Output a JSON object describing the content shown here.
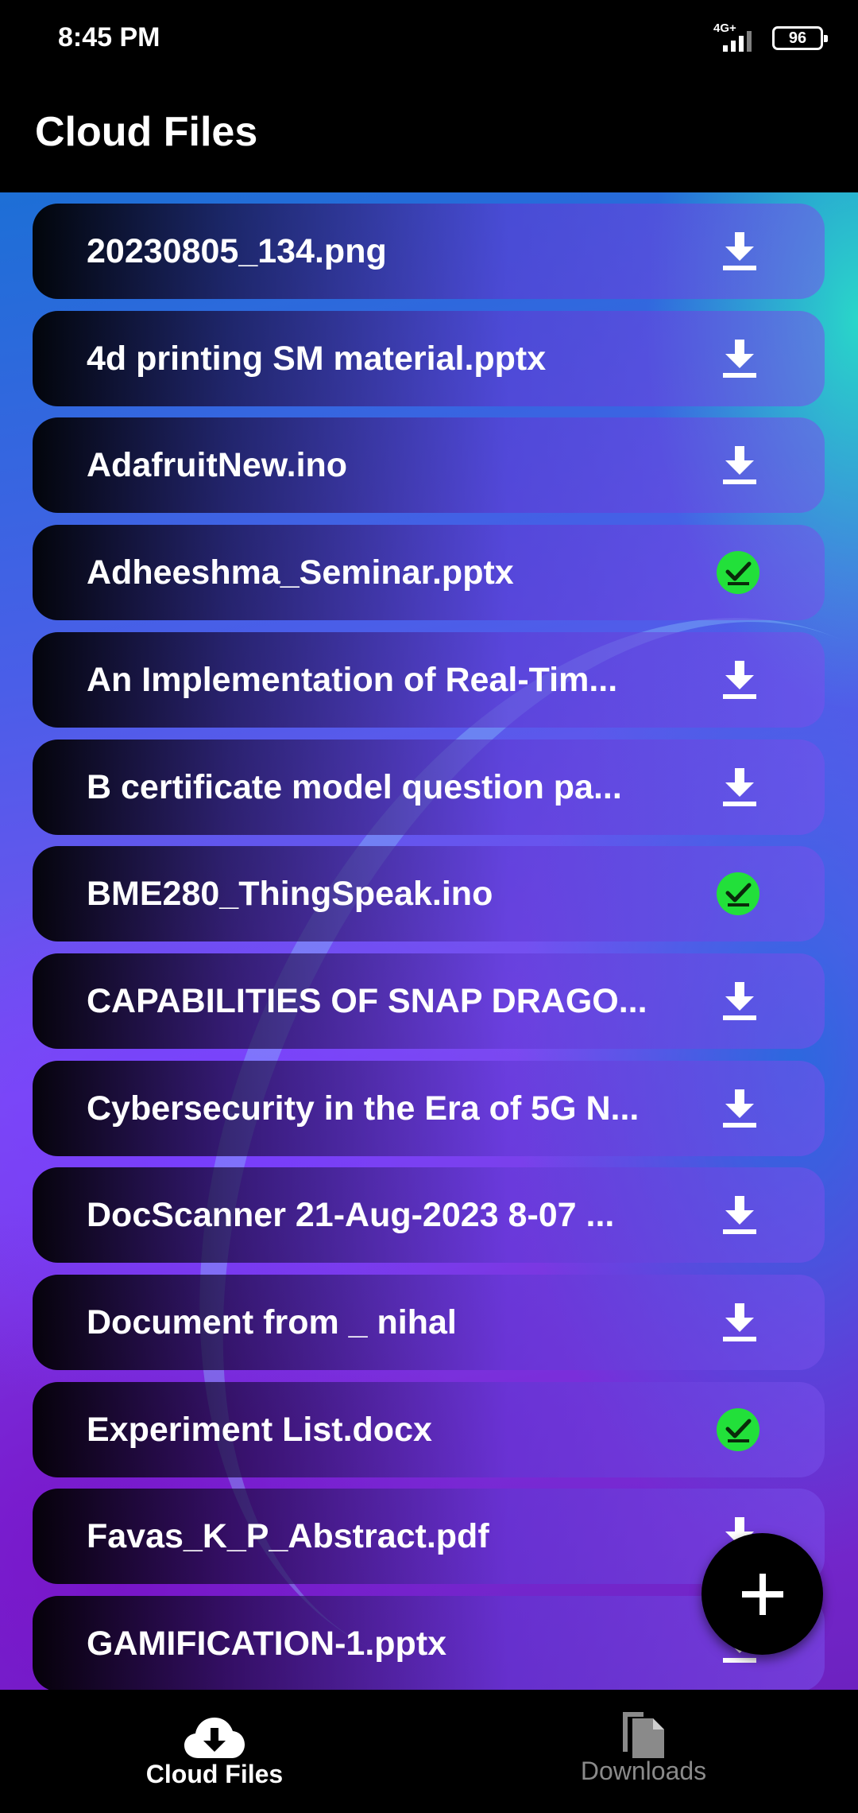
{
  "status_bar": {
    "time": "8:45 PM",
    "network_type": "4G+",
    "battery_level": "96"
  },
  "app_bar": {
    "title": "Cloud Files"
  },
  "files": [
    {
      "name": "20230805_134.png",
      "status": "download"
    },
    {
      "name": "4d printing SM material.pptx",
      "status": "download"
    },
    {
      "name": "AdafruitNew.ino",
      "status": "download"
    },
    {
      "name": "Adheeshma_Seminar.pptx",
      "status": "downloaded"
    },
    {
      "name": "An Implementation of Real-Tim...",
      "status": "download"
    },
    {
      "name": "B certificate model question pa...",
      "status": "download"
    },
    {
      "name": "BME280_ThingSpeak.ino",
      "status": "downloaded"
    },
    {
      "name": "CAPABILITIES OF SNAP DRAGO...",
      "status": "download"
    },
    {
      "name": "Cybersecurity in the Era of 5G N...",
      "status": "download"
    },
    {
      "name": "DocScanner 21-Aug-2023 8-07 ...",
      "status": "download"
    },
    {
      "name": "Document from _ nihal",
      "status": "download"
    },
    {
      "name": "Experiment List.docx",
      "status": "downloaded"
    },
    {
      "name": "Favas_K_P_Abstract.pdf",
      "status": "download"
    },
    {
      "name": "GAMIFICATION-1.pptx",
      "status": "download"
    }
  ],
  "fab": {
    "icon": "plus-icon"
  },
  "bottom_nav": {
    "items": [
      {
        "label": "Cloud Files",
        "icon": "cloud-download-icon",
        "active": true
      },
      {
        "label": "Downloads",
        "icon": "file-icon",
        "active": false
      }
    ]
  },
  "colors": {
    "downloaded_badge": "#22e03a",
    "inactive_nav": "#8a8a8a"
  }
}
